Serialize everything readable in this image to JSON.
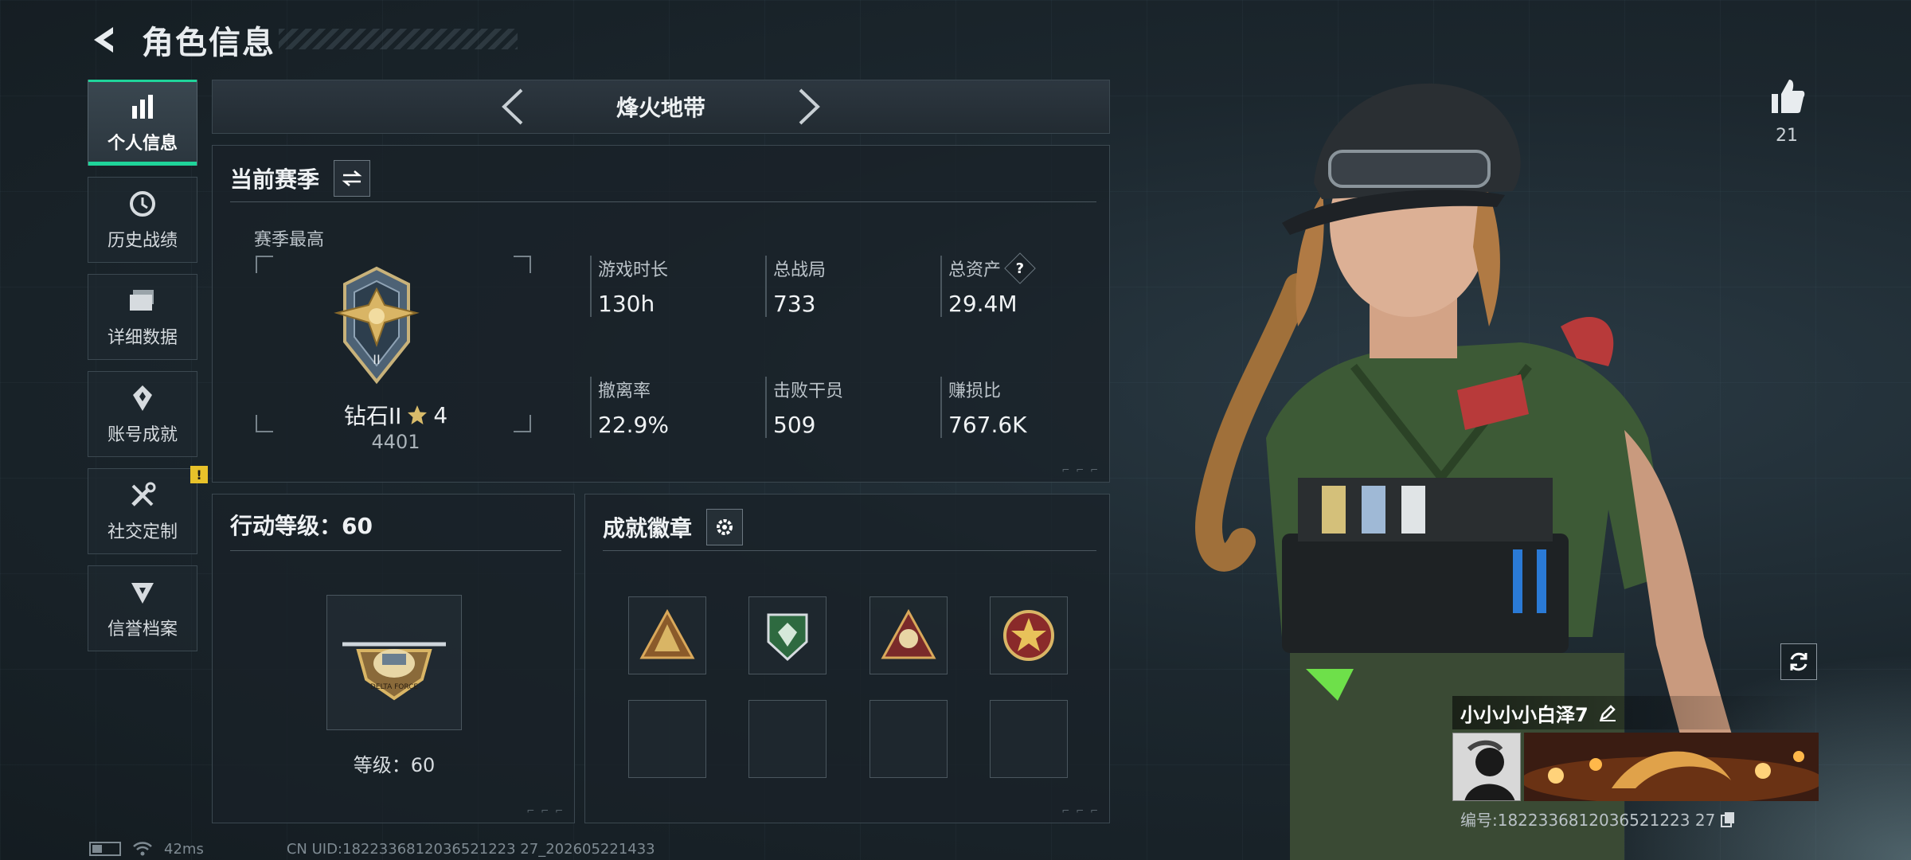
{
  "header": {
    "title": "角色信息"
  },
  "sidebar": {
    "items": [
      {
        "label": "个人信息",
        "icon": "bar-chart-icon",
        "active": true
      },
      {
        "label": "历史战绩",
        "icon": "history-clock-icon"
      },
      {
        "label": "详细数据",
        "icon": "folder-icon"
      },
      {
        "label": "账号成就",
        "icon": "achievement-icon"
      },
      {
        "label": "社交定制",
        "icon": "tools-icon",
        "alert": "!"
      },
      {
        "label": "信誉档案",
        "icon": "credit-shield-icon"
      }
    ]
  },
  "mode": {
    "title": "烽火地带"
  },
  "season": {
    "title": "当前赛季",
    "best_label": "赛季最高",
    "rank_name": "钻石II",
    "rank_stars": "4",
    "rank_score": "4401",
    "stats": [
      {
        "label": "游戏时长",
        "value": "130h"
      },
      {
        "label": "总战局",
        "value": "733"
      },
      {
        "label": "总资产",
        "value": "29.4M",
        "help": "?"
      },
      {
        "label": "撤离率",
        "value": "22.9%"
      },
      {
        "label": "击败干员",
        "value": "509"
      },
      {
        "label": "赚损比",
        "value": "767.6K"
      }
    ]
  },
  "level": {
    "title": "行动等级：60",
    "caption": "等级：60",
    "emblem_text": "DELTA FORCE"
  },
  "badges": {
    "title": "成就徽章",
    "filled": 4,
    "empty": 4
  },
  "likes": {
    "count": "21"
  },
  "player": {
    "name": "小小小小白泽7",
    "id": "编号:1822336812036521223 27"
  },
  "status": {
    "ping": "42ms",
    "uid": "CN UID:1822336812036521223 27_202605221433"
  },
  "colors": {
    "accent": "#1fd49a",
    "alert": "#e8c22a"
  }
}
